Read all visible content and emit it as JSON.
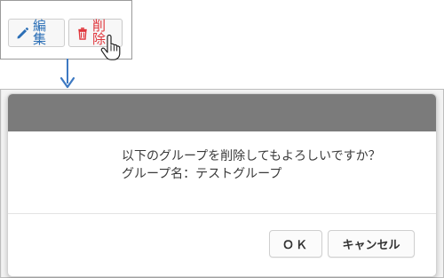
{
  "toolbar": {
    "edit_label": "編集",
    "delete_label": "削除",
    "edit_icon": "pencil-icon",
    "delete_icon": "trash-icon",
    "cursor_icon": "hand-pointer-icon"
  },
  "dialog": {
    "message_line_1": "以下のグループを削除してもよろしいですか？",
    "message_line_2": "グループ名：テストグループ",
    "ok_label": "ＯＫ",
    "cancel_label": "キャンセル"
  },
  "colors": {
    "edit_text": "#2b6fb6",
    "delete_text": "#e0343a",
    "dialog_header": "#7b7b7b",
    "connector": "#3d79c2"
  }
}
